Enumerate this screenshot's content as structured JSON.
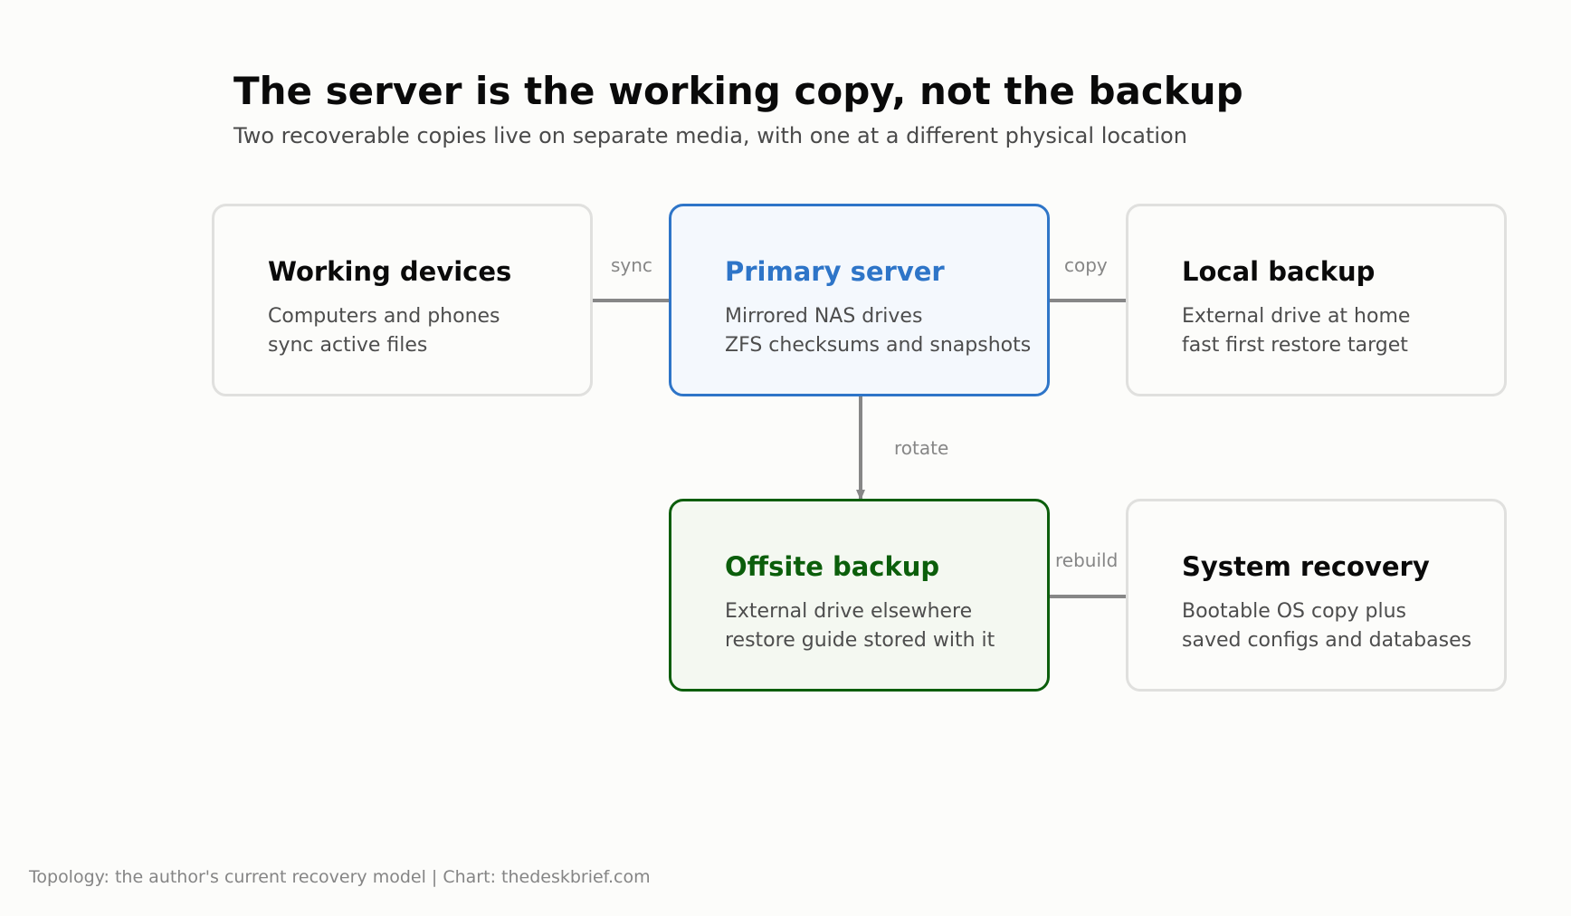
{
  "title": "The server is the working copy, not the backup",
  "subtitle": "Two recoverable copies live on separate media, with one at a different physical location",
  "nodes": {
    "working_devices": {
      "title": "Working devices",
      "line1": "Computers and phones",
      "line2": "sync active files"
    },
    "primary_server": {
      "title": "Primary server",
      "line1": "Mirrored NAS drives",
      "line2": "ZFS checksums and snapshots"
    },
    "local_backup": {
      "title": "Local backup",
      "line1": "External drive at home",
      "line2": "fast first restore target"
    },
    "offsite_backup": {
      "title": "Offsite backup",
      "line1": "External drive elsewhere",
      "line2": "restore guide stored with it"
    },
    "system_recovery": {
      "title": "System recovery",
      "line1": "Bootable OS copy plus",
      "line2": "saved configs and databases"
    }
  },
  "edges": {
    "sync": "sync",
    "copy": "copy",
    "rotate": "rotate",
    "rebuild": "rebuild"
  },
  "footer": "Topology: the author's current recovery model | Chart: thedeskbrief.com",
  "colors": {
    "primary_accent": "#2e75c8",
    "offsite_accent": "#0b5e0b",
    "neutral_border": "#e0e0de",
    "arrow": "#878787",
    "background": "#fcfcfa"
  }
}
